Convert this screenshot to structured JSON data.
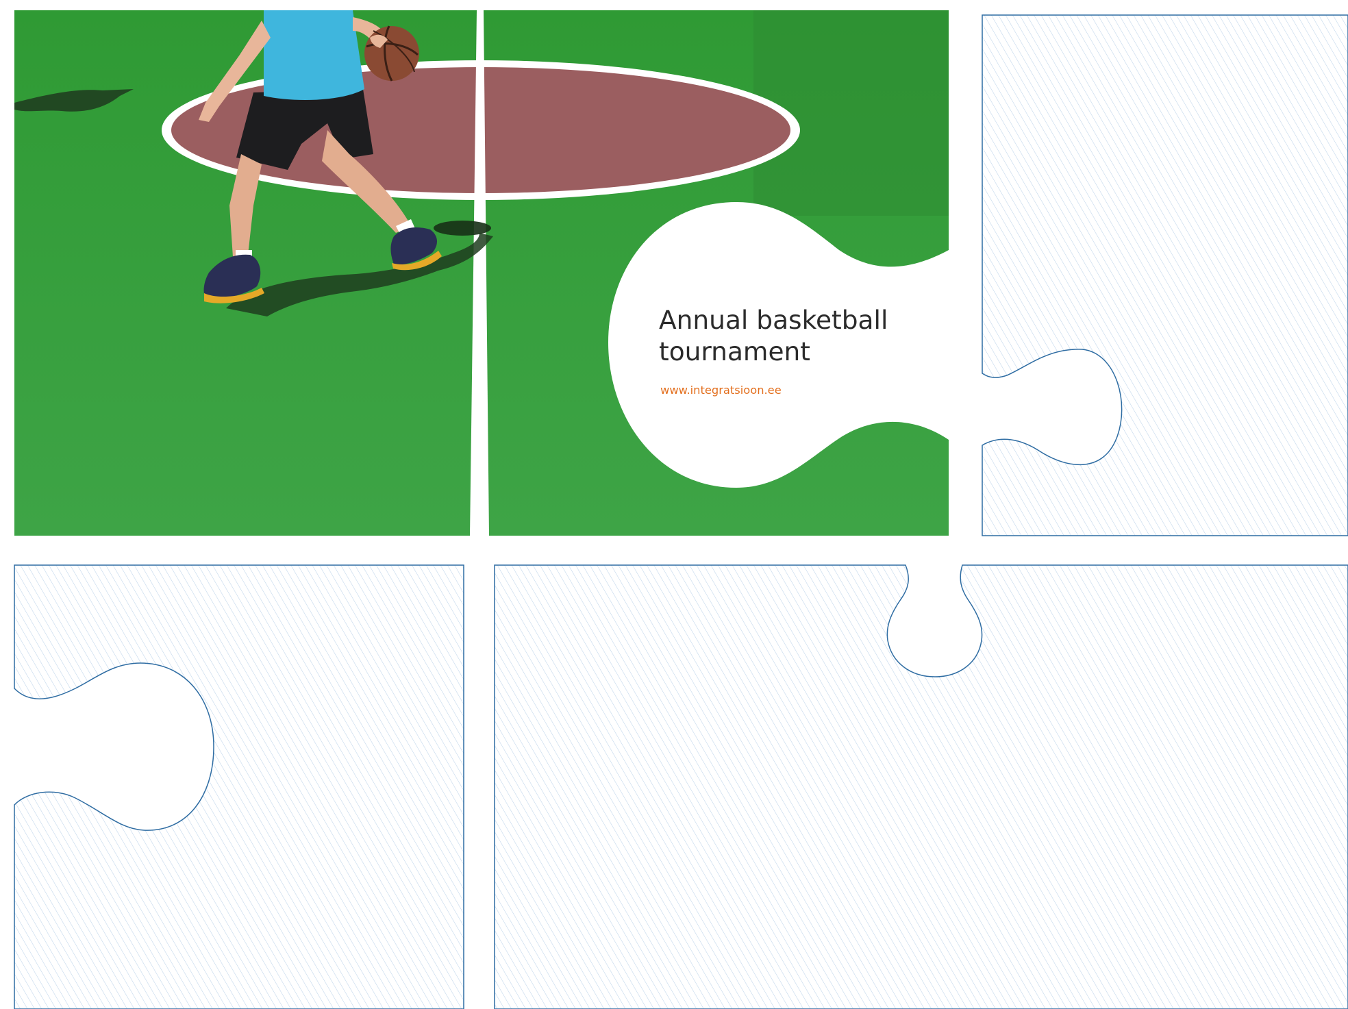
{
  "hero": {
    "title_line1": "Annual basketball",
    "title_line2": "tournament",
    "url": "www.integratsioon.ee"
  },
  "colors": {
    "court_green": "#3a9e3c",
    "court_center": "#9b5e60",
    "court_line": "#ffffff",
    "frame_blue": "#2f6da3",
    "hatch": "#bcd3ea",
    "title_text": "#2b2b2b",
    "accent_orange": "#e36f1e"
  },
  "icons": {
    "player": "basketball-player-icon",
    "ball": "basketball-icon"
  }
}
